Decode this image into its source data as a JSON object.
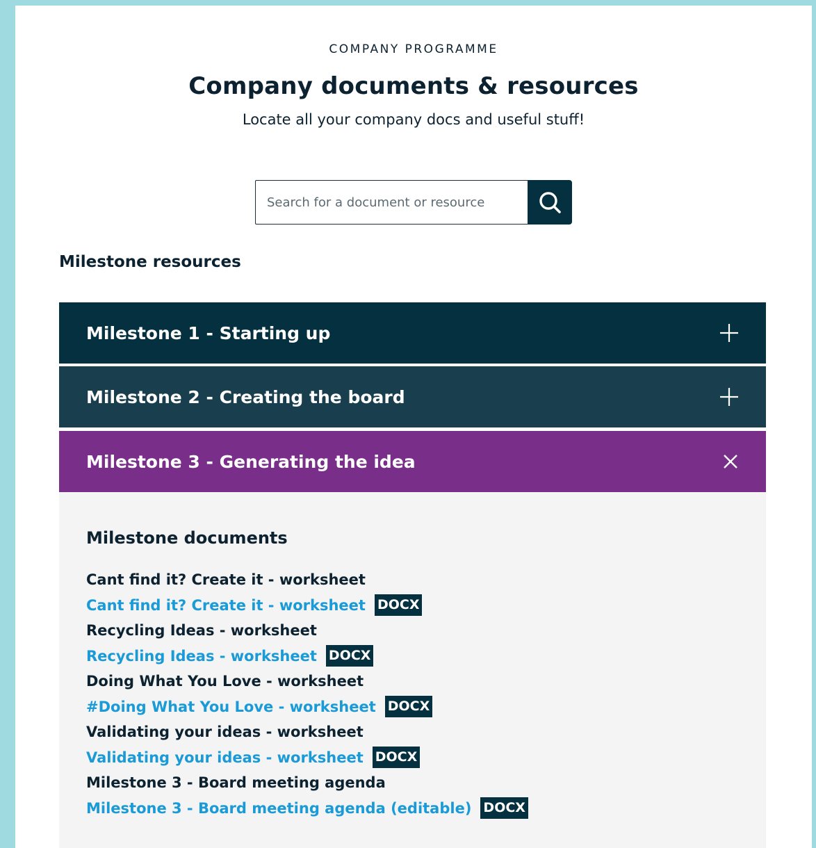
{
  "header": {
    "eyebrow": "COMPANY PROGRAMME",
    "title": "Company documents & resources",
    "subtitle": "Locate all your company docs and useful stuff!"
  },
  "search": {
    "placeholder": "Search for a document or resource",
    "button_icon": "search-icon"
  },
  "resources": {
    "heading": "Milestone resources",
    "milestones": [
      {
        "label": "Milestone 1 - Starting up",
        "icon": "plus-icon",
        "expanded": false
      },
      {
        "label": "Milestone 2 - Creating the board",
        "icon": "plus-icon",
        "expanded": false
      },
      {
        "label": "Milestone 3 - Generating the idea",
        "icon": "close-icon",
        "expanded": true
      }
    ]
  },
  "milestone3": {
    "documents_heading": "Milestone documents",
    "documents": [
      {
        "title": "Cant find it? Create it - worksheet",
        "link": "Cant find it? Create it - worksheet",
        "format": "DOCX"
      },
      {
        "title": "Recycling Ideas - worksheet",
        "link": "Recycling Ideas - worksheet",
        "format": "DOCX"
      },
      {
        "title": "Doing What You Love - worksheet",
        "link": "#Doing What You Love - worksheet",
        "format": "DOCX"
      },
      {
        "title": "Validating your ideas - worksheet",
        "link": "Validating your ideas - worksheet",
        "format": "DOCX"
      },
      {
        "title": "Milestone 3 - Board meeting agenda",
        "link": "Milestone 3 - Board meeting agenda (editable)",
        "format": "DOCX"
      }
    ]
  },
  "colors": {
    "background": "#9fdae0",
    "navy": "#04303f",
    "teal_dark": "#193f4e",
    "purple": "#792e89",
    "link_blue": "#1a9ad6"
  }
}
